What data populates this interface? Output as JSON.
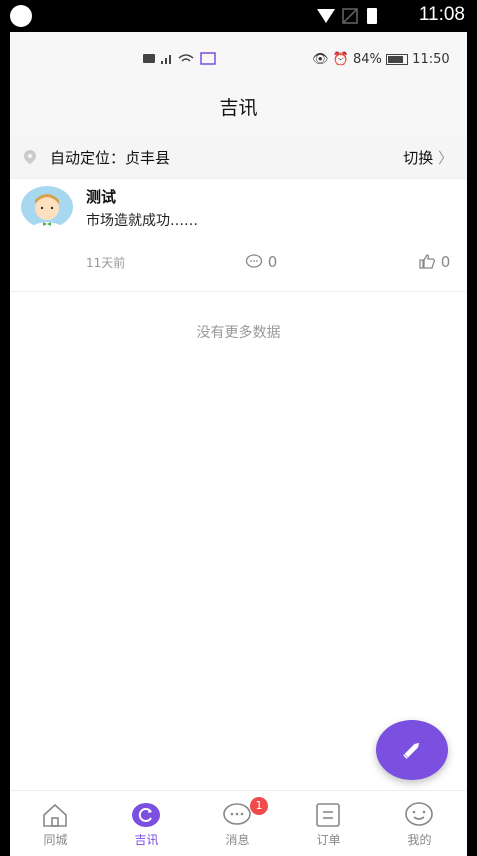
{
  "outer_status": {
    "time": "11:08"
  },
  "inner_status": {
    "battery": "84%",
    "time": "11:50"
  },
  "header": {
    "title": "吉讯"
  },
  "location": {
    "label": "自动定位：贞丰县",
    "switch_label": "切换"
  },
  "post": {
    "author": "测试",
    "content": "市场造就成功……",
    "time": "11天前",
    "comments": "0",
    "likes": "0"
  },
  "list_end": "没有更多数据",
  "bottom_nav": {
    "items": [
      {
        "label": "同城",
        "icon": "house-icon"
      },
      {
        "label": "吉讯",
        "icon": "refresh-icon"
      },
      {
        "label": "消息",
        "icon": "chat-icon"
      },
      {
        "label": "订单",
        "icon": "order-icon"
      },
      {
        "label": "我的",
        "icon": "face-icon"
      }
    ],
    "message_badge": "1",
    "active_color": "#7b4fe0"
  },
  "colors": {
    "accent": "#7b4fe0",
    "badge": "#f04a4a"
  }
}
